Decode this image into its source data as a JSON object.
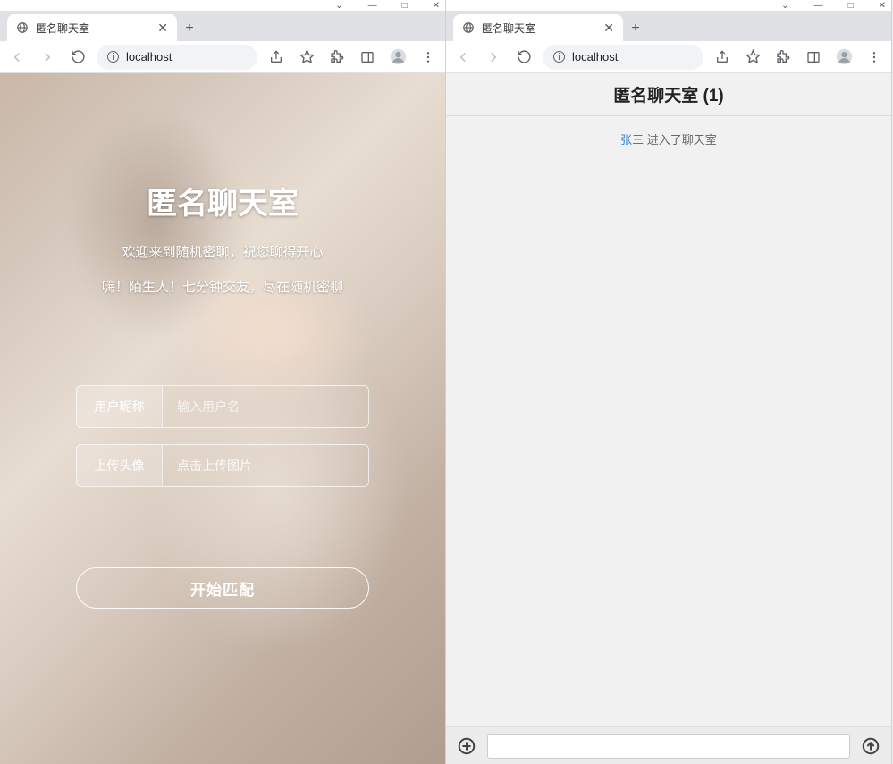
{
  "left": {
    "tab_title": "匿名聊天室",
    "url": "localhost",
    "app_title": "匿名聊天室",
    "subtitle1": "欢迎来到随机密聊，祝您聊得开心",
    "subtitle2": "嗨！陌生人！七分钟交友，尽在随机密聊",
    "nickname_label": "用户昵称",
    "nickname_placeholder": "输入用户名",
    "avatar_label": "上传头像",
    "avatar_placeholder": "点击上传图片",
    "match_button": "开始匹配"
  },
  "right": {
    "tab_title": "匿名聊天室",
    "url": "localhost",
    "room_title": "匿名聊天室 (1)",
    "sysmsg_user": "张三",
    "sysmsg_text": " 进入了聊天室"
  }
}
